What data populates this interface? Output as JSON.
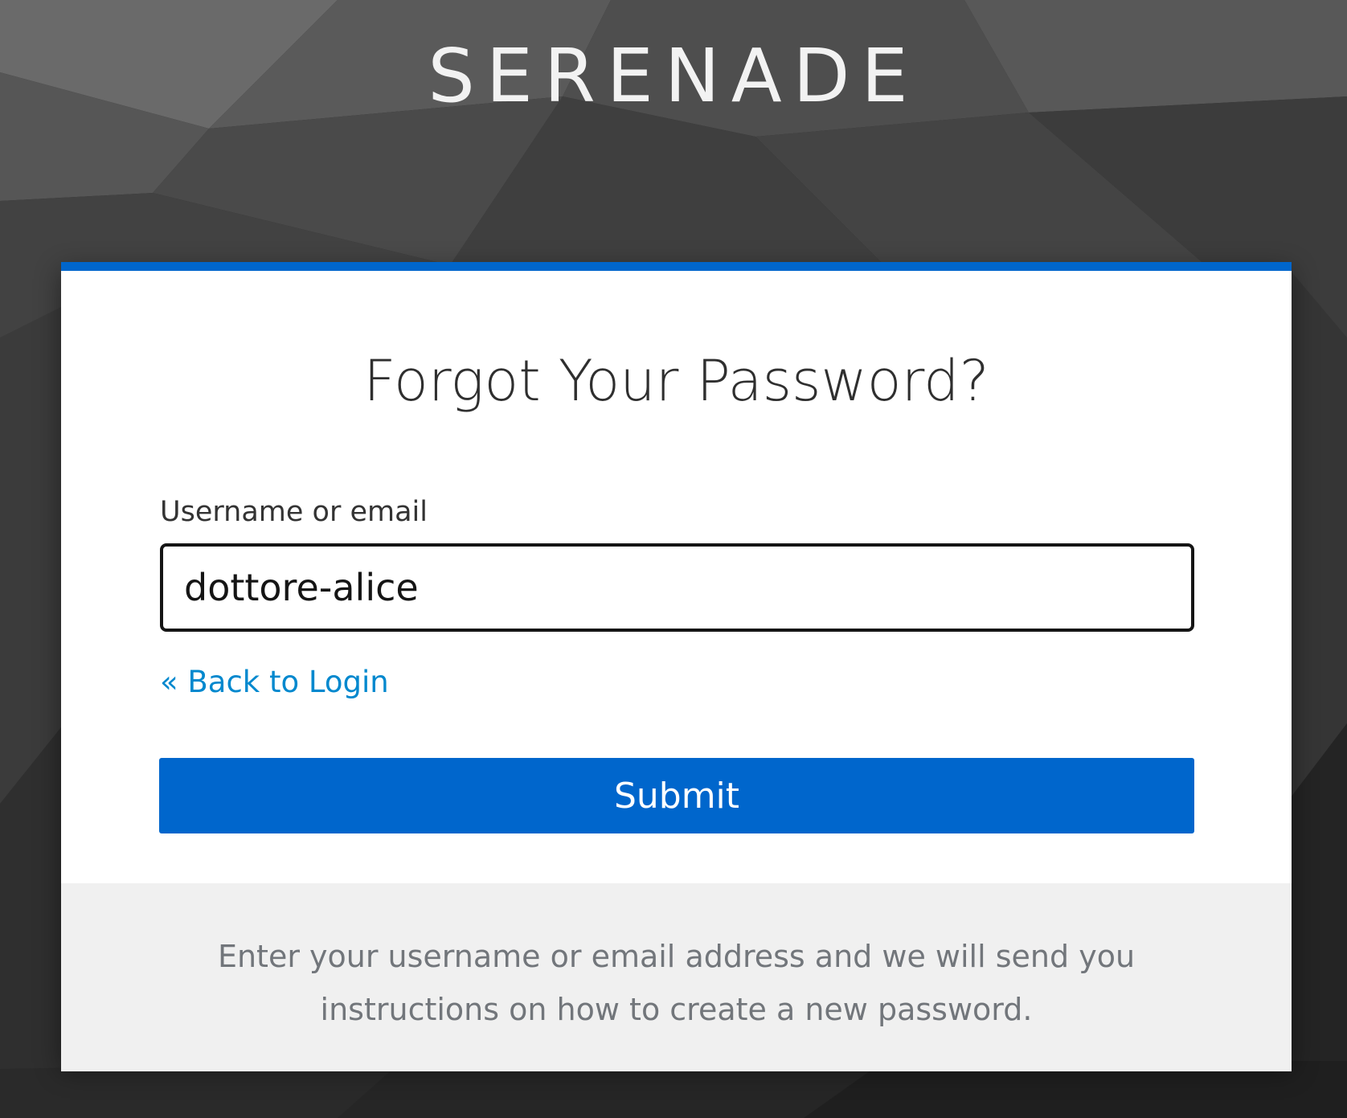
{
  "brand": {
    "logo_text": "SERENADE"
  },
  "card": {
    "title": "Forgot Your Password?",
    "username_label": "Username or email",
    "username_value": "dottore-alice",
    "back_link": "« Back to Login",
    "submit_label": "Submit",
    "info_text": "Enter your username or email address and we will send you instructions on how to create a new password."
  },
  "colors": {
    "accent": "#0066cc",
    "link": "#0088ce",
    "background": "#2e2e2e",
    "info_panel": "#f0f0f0",
    "info_text": "#72767b"
  }
}
